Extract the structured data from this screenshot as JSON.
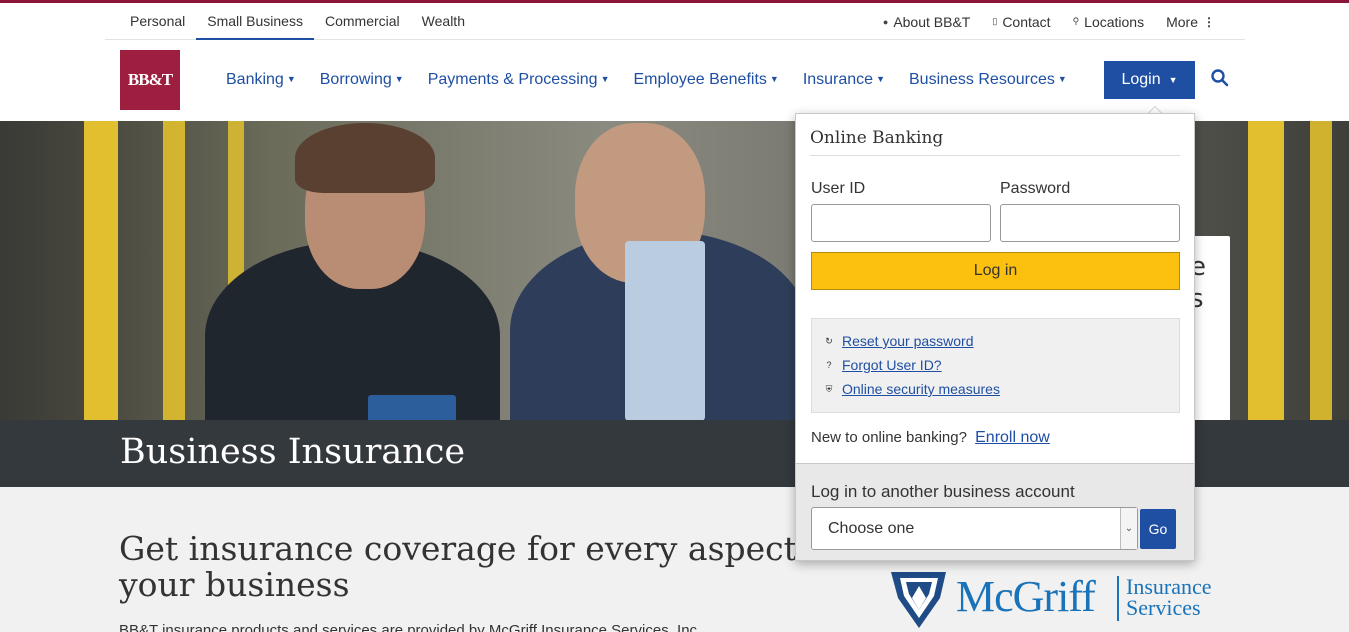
{
  "utility": {
    "segments": [
      "Personal",
      "Small Business",
      "Commercial",
      "Wealth"
    ],
    "links": {
      "about": "About BB&T",
      "contact": "Contact",
      "locations": "Locations",
      "more": "More"
    }
  },
  "logo": {
    "text": "BB&T"
  },
  "nav": {
    "items": [
      "Banking",
      "Borrowing",
      "Payments & Processing",
      "Employee Benefits",
      "Insurance",
      "Business Resources"
    ],
    "login_label": "Login"
  },
  "hero": {
    "title": "Business Insurance",
    "card_text": [
      "e",
      "s"
    ]
  },
  "main": {
    "headline": "Get insurance coverage for every aspect of your business",
    "cutoff_text": "BB&T insurance products and services are provided by McGriff Insurance Services, Inc."
  },
  "partner": {
    "name": "McGriff",
    "sub_line1": "Insurance",
    "sub_line2": "Services"
  },
  "login_dropdown": {
    "title": "Online Banking",
    "user_id_label": "User ID",
    "password_label": "Password",
    "user_id_value": "",
    "password_value": "",
    "submit_label": "Log in",
    "help_links": [
      "Reset your password",
      "Forgot User ID?",
      "Online security measures"
    ],
    "new_user_text": "New to online banking?",
    "enroll_label": "Enroll now",
    "other_account_label": "Log in to another business account",
    "select_value": "Choose one",
    "go_label": "Go"
  },
  "colors": {
    "brand": "#9e1e3f",
    "link_blue": "#1f4fa3",
    "login_yellow": "#fcc00e",
    "title_bar": "#34393e"
  }
}
